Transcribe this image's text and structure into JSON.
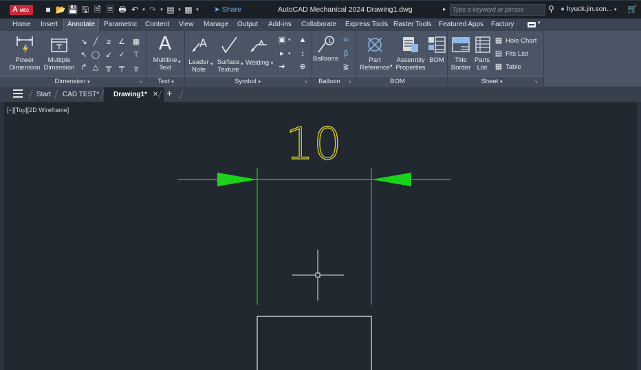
{
  "title_bar": {
    "app_badge": "A",
    "app_badge_sub": "MEC",
    "share_label": "Share",
    "app_name": "AutoCAD Mechanical 2024",
    "document_name": "Drawing1.dwg",
    "search_placeholder": "Type a keyword or phrase",
    "user_name": "hyuck.jin.son..."
  },
  "ribbon_tabs": [
    "Home",
    "Insert",
    "Annotate",
    "Parametric",
    "Content",
    "View",
    "Manage",
    "Output",
    "Add-ins",
    "Collaborate",
    "Express Tools",
    "Raster Tools",
    "Featured Apps",
    "Factory"
  ],
  "active_tab": "Annotate",
  "ribbon": {
    "dimension": {
      "title": "Dimension",
      "power_dimension": [
        "Power",
        "Dimension"
      ],
      "multiple_dimension": [
        "Multiple",
        "Dimension"
      ]
    },
    "text": {
      "title": "Text",
      "multiline_text": [
        "Multiline",
        "Text"
      ]
    },
    "symbol": {
      "title": "Symbol",
      "leader_note": [
        "Leader",
        "Note"
      ],
      "surface_texture": [
        "Surface",
        "Texture"
      ],
      "welding": "Welding"
    },
    "balloon": {
      "title": "Balloon",
      "balloons": "Balloons"
    },
    "bom": {
      "title": "BOM",
      "part_reference": [
        "Part",
        "Reference"
      ],
      "assembly_properties": [
        "Assembly",
        "Properties"
      ],
      "bom": "BOM"
    },
    "sheet": {
      "title": "Sheet",
      "title_border": [
        "Title",
        "Border"
      ],
      "parts_list": [
        "Parts",
        "List"
      ],
      "hole_chart": "Hole Chart",
      "fits_list": "Fits List",
      "table": "Table"
    }
  },
  "doc_tabs": {
    "start": "Start",
    "cad_test": "CAD TEST*",
    "drawing1": "Drawing1*"
  },
  "viewport": {
    "label": "[−][Top][2D Wireframe]",
    "dimension_text": "10"
  },
  "colors": {
    "dimension_green": "#19d219",
    "dimension_text_yellow": "#d8d12a",
    "geometry_white": "#e6e9ec",
    "background": "#212830"
  }
}
